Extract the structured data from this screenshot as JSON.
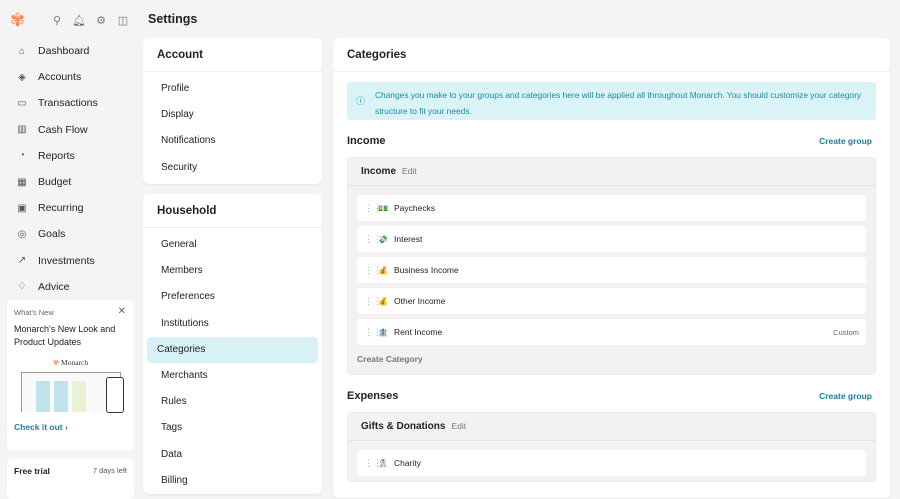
{
  "header": {
    "title": "Settings"
  },
  "sidebar": {
    "items": [
      {
        "label": "Dashboard",
        "icon": "⌂"
      },
      {
        "label": "Accounts",
        "icon": "◈"
      },
      {
        "label": "Transactions",
        "icon": "▭"
      },
      {
        "label": "Cash Flow",
        "icon": "▥"
      },
      {
        "label": "Reports",
        "icon": "◔"
      },
      {
        "label": "Budget",
        "icon": "▦"
      },
      {
        "label": "Recurring",
        "icon": "▣"
      },
      {
        "label": "Goals",
        "icon": "◎"
      },
      {
        "label": "Investments",
        "icon": "↗"
      },
      {
        "label": "Advice",
        "icon": "♢"
      }
    ],
    "whats_new": {
      "tag": "What's New",
      "headline": "Monarch's New Look and Product Updates",
      "logo_text": "Monarch",
      "link": "Check it out ›"
    },
    "trial": {
      "label": "Free trial",
      "days": "7 days left"
    }
  },
  "settings_nav": {
    "account_title": "Account",
    "account_items": [
      "Profile",
      "Display",
      "Notifications",
      "Security"
    ],
    "household_title": "Household",
    "household_items": [
      "General",
      "Members",
      "Preferences",
      "Institutions",
      "Categories",
      "Merchants",
      "Rules",
      "Tags",
      "Data",
      "Billing"
    ],
    "active": "Categories"
  },
  "main": {
    "title": "Categories",
    "info": "Changes you make to your groups and categories here will be applied all throughout Monarch. You should customize your category structure to fit your needs.",
    "income": {
      "title": "Income",
      "create_group": "Create group",
      "group": "Income",
      "edit": "Edit",
      "rows": [
        {
          "emoji": "💵",
          "name": "Paychecks",
          "tag": ""
        },
        {
          "emoji": "💸",
          "name": "Interest",
          "tag": ""
        },
        {
          "emoji": "💰",
          "name": "Business Income",
          "tag": ""
        },
        {
          "emoji": "💰",
          "name": "Other Income",
          "tag": ""
        },
        {
          "emoji": "🏦",
          "name": "Rent Income",
          "tag": "Custom"
        }
      ],
      "create_category": "Create Category"
    },
    "expenses": {
      "title": "Expenses",
      "create_group": "Create group",
      "group": "Gifts & Donations",
      "edit": "Edit",
      "rows": [
        {
          "emoji": "🎗",
          "name": "Charity"
        }
      ]
    }
  },
  "colors": {
    "accent": "#1b7d93",
    "info_bg": "#d9f3f7",
    "active_bg": "#d8f1f6",
    "logo": "#f08a5d"
  }
}
